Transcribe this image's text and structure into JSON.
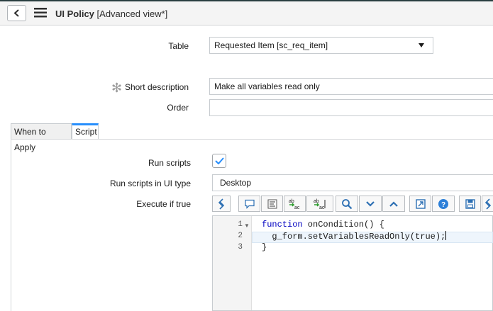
{
  "header": {
    "title": "UI Policy",
    "subtitle": "[Advanced view*]"
  },
  "form": {
    "table_label": "Table",
    "table_value": "Requested Item [sc_req_item]",
    "short_description_label": "Short description",
    "short_description_value": "Make all variables read only",
    "order_label": "Order",
    "order_value": ""
  },
  "tabs": [
    {
      "label": "When to Apply"
    },
    {
      "label": "Script"
    }
  ],
  "script": {
    "run_scripts_label": "Run scripts",
    "run_scripts_checked": true,
    "ui_type_label": "Run scripts in UI type",
    "ui_type_value": "Desktop",
    "execute_label": "Execute if true"
  },
  "toolbar": {
    "icons": [
      "toggle-syntax-icon",
      "comment-icon",
      "format-code-icon",
      "replace-icon",
      "replace-all-icon",
      "search-icon",
      "collapse-icon",
      "expand-icon",
      "fullscreen-icon",
      "help-icon",
      "save-icon",
      "toggle-syntax-icon"
    ]
  },
  "editor": {
    "line_numbers": [
      "1",
      "2",
      "3"
    ],
    "lines": [
      {
        "keyword": "function",
        "text": " onCondition() {"
      },
      {
        "keyword": "",
        "text": "  g_form.setVariablesReadOnly(true);"
      },
      {
        "keyword": "",
        "text": "}"
      }
    ]
  },
  "colors": {
    "accent": "#278efc",
    "header_bg": "#f4f4f4",
    "top_bar": "#293e40"
  }
}
